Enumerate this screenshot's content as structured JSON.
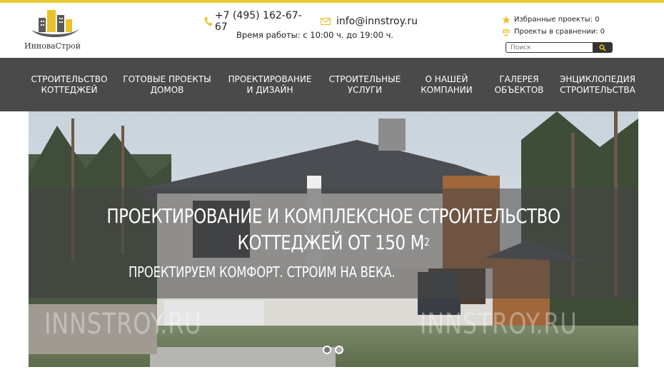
{
  "header": {
    "logo_text": "ИнноваСтрой",
    "phone": "+7 (495) 162-67-67",
    "email": "info@innstroy.ru",
    "hours": "Время работы: с 10:00 ч. до 19:00 ч.",
    "favorites": "Избранные проекты: 0",
    "compare": "Проекты в сравнении: 0",
    "search_placeholder": "Поиск"
  },
  "nav": {
    "items": [
      {
        "label": "СТРОИТЕЛЬСТВО\nКОТТЕДЖЕЙ"
      },
      {
        "label": "ГОТОВЫЕ ПРОЕКТЫ\nДОМОВ"
      },
      {
        "label": "ПРОЕКТИРОВАНИЕ\nИ ДИЗАЙН"
      },
      {
        "label": "СТРОИТЕЛЬНЫЕ\nУСЛУГИ"
      },
      {
        "label": "О НАШЕЙ\nКОМПАНИИ"
      },
      {
        "label": "ГАЛЕРЕЯ\nОБЪЕКТОВ"
      },
      {
        "label": "ЭНЦИКЛОПЕДИЯ\nСТРОИТЕЛЬСТВА"
      }
    ]
  },
  "hero": {
    "title_line1": "ПРОЕКТИРОВАНИЕ И КОМПЛЕКСНОЕ СТРОИТЕЛЬСТВО",
    "title_line2": "КОТТЕДЖЕЙ ОТ 150 М",
    "title_sup": "2",
    "subtitle": "ПРОЕКТИРУЕМ КОМФОРТ. СТРОИМ НА ВЕКА.",
    "watermark": "INNSTROY.RU",
    "slides": 2,
    "active_slide": 1
  },
  "colors": {
    "accent": "#e4cc3a",
    "nav_bg": "#4a4a4a",
    "icon_yellow": "#e8c22a"
  }
}
